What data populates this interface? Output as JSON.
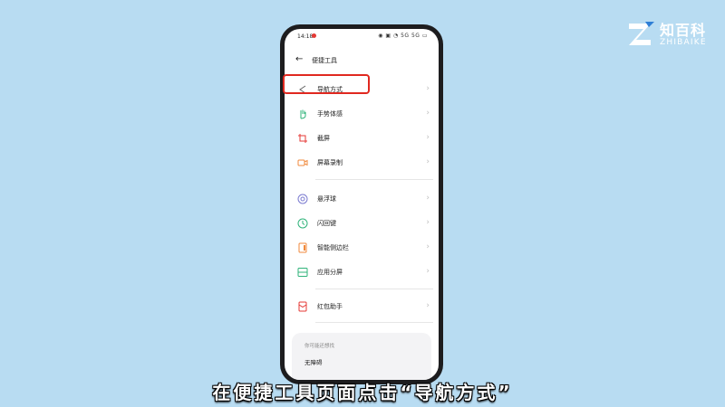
{
  "logo": {
    "zh": "知百科",
    "en": "ZHIBAIKE"
  },
  "status_bar": {
    "time": "14:18",
    "right": "◉ ▣ ◔ 5G 5G ▭"
  },
  "header": {
    "title": "便捷工具"
  },
  "items": [
    {
      "label": "导航方式",
      "icon": "navigation-icon"
    },
    {
      "label": "手势体感",
      "icon": "hand-gesture-icon"
    },
    {
      "label": "截屏",
      "icon": "crop-icon"
    },
    {
      "label": "屏幕录制",
      "icon": "screen-record-icon"
    },
    {
      "label": "悬浮球",
      "icon": "floating-ball-icon"
    },
    {
      "label": "闪回键",
      "icon": "flashback-icon"
    },
    {
      "label": "智能侧边栏",
      "icon": "smart-sidebar-icon"
    },
    {
      "label": "应用分屏",
      "icon": "split-screen-icon"
    },
    {
      "label": "红包助手",
      "icon": "red-envelope-icon"
    }
  ],
  "card": {
    "subtitle": "你可能还想找",
    "value": "无障碍"
  },
  "caption": "在便捷工具页面点击“导航方式”",
  "colors": {
    "background": "#b8dcf2",
    "highlight": "#e0281f",
    "accent_orange": "#f08a3c",
    "accent_green": "#2fb37a"
  }
}
